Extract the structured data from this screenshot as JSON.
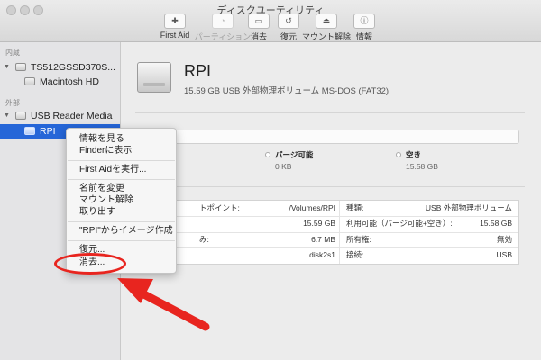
{
  "window": {
    "title": "ディスクユーティリティ"
  },
  "toolbar": {
    "buttons": [
      {
        "label": "First Aid",
        "icon": "stethoscope-icon",
        "glyph": "✚",
        "enabled": true
      },
      {
        "label": "パーティション",
        "icon": "pie-chart-icon",
        "glyph": "◔",
        "enabled": false
      },
      {
        "label": "消去",
        "icon": "erase-icon",
        "glyph": "▭",
        "enabled": true
      },
      {
        "label": "復元",
        "icon": "restore-icon",
        "glyph": "↺",
        "enabled": true
      },
      {
        "label": "マウント解除",
        "icon": "unmount-icon",
        "glyph": "⏏",
        "enabled": true
      },
      {
        "label": "情報",
        "icon": "info-icon",
        "glyph": "ⓘ",
        "enabled": true
      }
    ]
  },
  "sidebar": {
    "internal_header": "内蔵",
    "external_header": "外部",
    "internal_items": [
      {
        "label": "TS512GSSD370S...",
        "level": 0
      },
      {
        "label": "Macintosh HD",
        "level": 1
      }
    ],
    "external_items": [
      {
        "label": "USB Reader Media",
        "level": 0
      },
      {
        "label": "RPI",
        "level": 1,
        "selected": true
      }
    ]
  },
  "volume": {
    "name": "RPI",
    "description": "15.59 GB USB 外部物理ボリューム MS-DOS (FAT32)"
  },
  "usage": {
    "purgeable_label": "パージ可能",
    "purgeable_value": "0 KB",
    "free_label": "空き",
    "free_value": "15.58 GB"
  },
  "info": {
    "left": [
      {
        "label": "トポイント:",
        "value": "/Volumes/RPI"
      },
      {
        "label": "",
        "value": "15.59 GB"
      },
      {
        "label": "み:",
        "value": "6.7 MB"
      },
      {
        "label": "",
        "value": "disk2s1"
      }
    ],
    "right": [
      {
        "label": "種類:",
        "value": "USB 外部物理ボリューム"
      },
      {
        "label": "利用可能（パージ可能+空き）:",
        "value": "15.58 GB"
      },
      {
        "label": "所有権:",
        "value": "無効"
      },
      {
        "label": "接続:",
        "value": "USB"
      }
    ]
  },
  "context_menu": {
    "items": [
      "情報を見る",
      "Finderに表示",
      "First Aidを実行...",
      "名前を変更",
      "マウント解除",
      "取り出す",
      "\"RPI\"からイメージ作成",
      "復元...",
      "消去..."
    ]
  },
  "annotation_color": "#e8251f"
}
